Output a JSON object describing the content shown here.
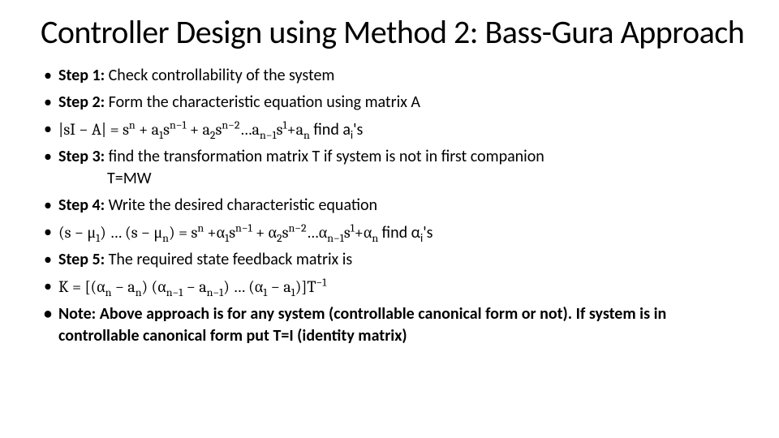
{
  "title": "Controller Design using Method 2: Bass-Gura Approach",
  "steps": {
    "step1_label": "Step 1:",
    "step1_text": " Check controllability of the system",
    "step2_label": "Step 2:",
    "step2_text": " Form the characteristic equation using matrix A",
    "charpoly_pre": "|sI − A| = s",
    "charpoly_mid1": " + a",
    "charpoly_mid2": "s",
    "charpoly_mid3": " + a",
    "charpoly_mid4": "s",
    "charpoly_mid5": "…a",
    "charpoly_mid6": "s",
    "charpoly_mid7": "+a",
    "charpoly_tail": " find a",
    "charpoly_tail2": "'s",
    "step3_label": "Step 3:",
    "step3_text": " find the transformation matrix T if system is not in first companion",
    "step3_sub": "T=MW",
    "step4_label": "Step 4:",
    "step4_text": " Write the desired characteristic equation",
    "desired_pre": "(s − μ",
    "desired_mid1": ") … (s − μ",
    "desired_mid2": ") = s",
    "desired_mid3": " +α",
    "desired_mid4": "s",
    "desired_mid5": " + α",
    "desired_mid6": "s",
    "desired_mid7": "…α",
    "desired_mid8": "s",
    "desired_mid9": "+α",
    "desired_tail": " find α",
    "desired_tail2": "'s",
    "step5_label": "Step 5:",
    "step5_text": " The required state feedback matrix is",
    "k_pre": "K = [(α",
    "k_mid1": " − a",
    "k_mid2": ")   (α",
    "k_mid3": " − a",
    "k_mid4": ") …   (α",
    "k_mid5": " − a",
    "k_mid6": ")]T",
    "note_label": "Note: ",
    "note_text": "Above approach is for any system (controllable canonical form or not). If system is in controllable canonical form put T=I (identity matrix)"
  },
  "exp": {
    "n": "n",
    "nm1": "n−1",
    "nm2": "n−2",
    "one": "1",
    "two": "2",
    "i": "i",
    "inv": "−1"
  }
}
